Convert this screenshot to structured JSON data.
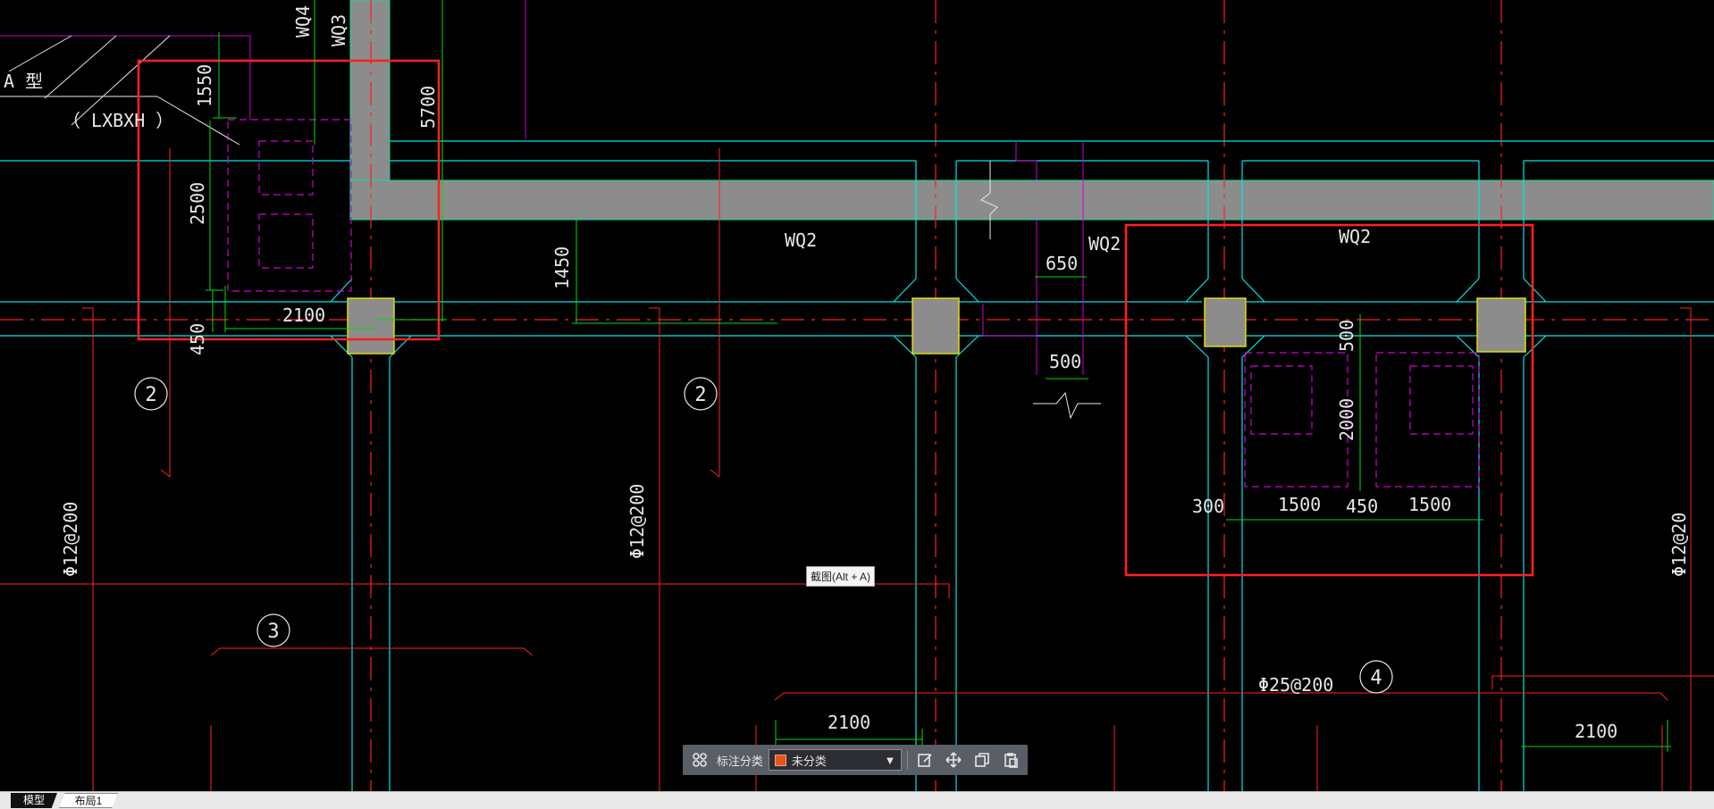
{
  "drawing": {
    "labels": {
      "wq4": "WQ4",
      "wq3": "WQ3",
      "type_a": "A 型",
      "lxbxh": "（ LXBXH ）",
      "wq2_a": "WQ2",
      "wq2_b": "WQ2",
      "wq2_c": "WQ2",
      "rebar_left": "Φ12@200",
      "rebar_mid": "Φ12@200",
      "rebar_right": "Φ12@20",
      "rebar_bottom": "Φ25@200"
    },
    "dimensions": {
      "d1550": "1550",
      "d5700": "5700",
      "d2500": "2500",
      "d1450": "1450",
      "d2100_top": "2100",
      "d450_v": "450",
      "d650": "650",
      "d500_a": "500",
      "d500_b": "500",
      "d2000": "2000",
      "d300": "300",
      "d1500_a": "1500",
      "d450_h": "450",
      "d1500_b": "1500",
      "d2100_bl": "2100",
      "d2100_br": "2100"
    },
    "section_marks": {
      "s2a": "2",
      "s2b": "2",
      "s3": "3",
      "s4": "4"
    }
  },
  "tooltip": "截图(Alt + A)",
  "toolbar": {
    "category_label": "标注分类",
    "category_value": "未分类",
    "category_color": "#e8551a"
  },
  "tabs": [
    {
      "label": "模型",
      "active": true
    },
    {
      "label": "布局1",
      "active": false
    }
  ],
  "colors": {
    "background": "#000000",
    "cyan": "#00e5e5",
    "red": "#ff2020",
    "green": "#00e000",
    "magenta": "#d000d0",
    "gray_wall": "#8c8c8c",
    "column_yellow": "#e6e600"
  }
}
